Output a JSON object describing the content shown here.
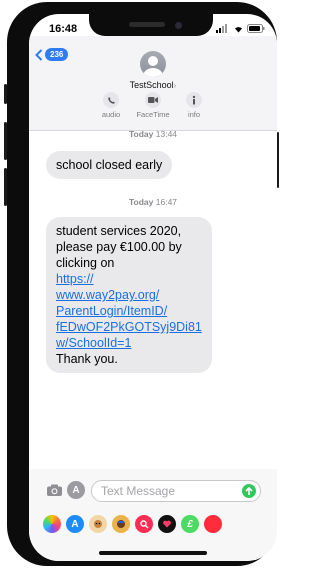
{
  "status_bar": {
    "time": "16:48"
  },
  "header": {
    "back_badge": "236",
    "contact_name": "TestSchool",
    "contact_chevron": "›",
    "actions": [
      {
        "label": "audio",
        "icon": "phone-icon"
      },
      {
        "label": "FaceTime",
        "icon": "video-icon"
      },
      {
        "label": "info",
        "icon": "info-icon"
      }
    ]
  },
  "messages": [
    {
      "day": "Today",
      "time": "13:44",
      "text": "school closed early"
    },
    {
      "day": "Today",
      "time": "16:47",
      "text_before": "student services 2020, please pay €100.00 by clicking on",
      "link": "https://www.way2pay.org/ParentLogin/ItemID/fEDwOF2PkGOTSyj9Di81w/SchoolId=1",
      "link_lines": [
        "https://",
        "www.way2pay.org/",
        "ParentLogin/ItemID/",
        "fEDwOF2PkGOTSyj9Di81",
        "w/SchoolId=1"
      ],
      "text_after": "Thank you."
    }
  ],
  "composer": {
    "placeholder": "Text Message",
    "app_tray": [
      "photos-icon",
      "app-store-icon",
      "memoji-icon",
      "animoji-icon",
      "search-images-icon",
      "digital-touch-icon",
      "payment-icon",
      "music-icon"
    ]
  },
  "colors": {
    "accent": "#2f7cf6",
    "bubble": "#e9e9eb",
    "link": "#1a6fe0",
    "send": "#34c759"
  }
}
